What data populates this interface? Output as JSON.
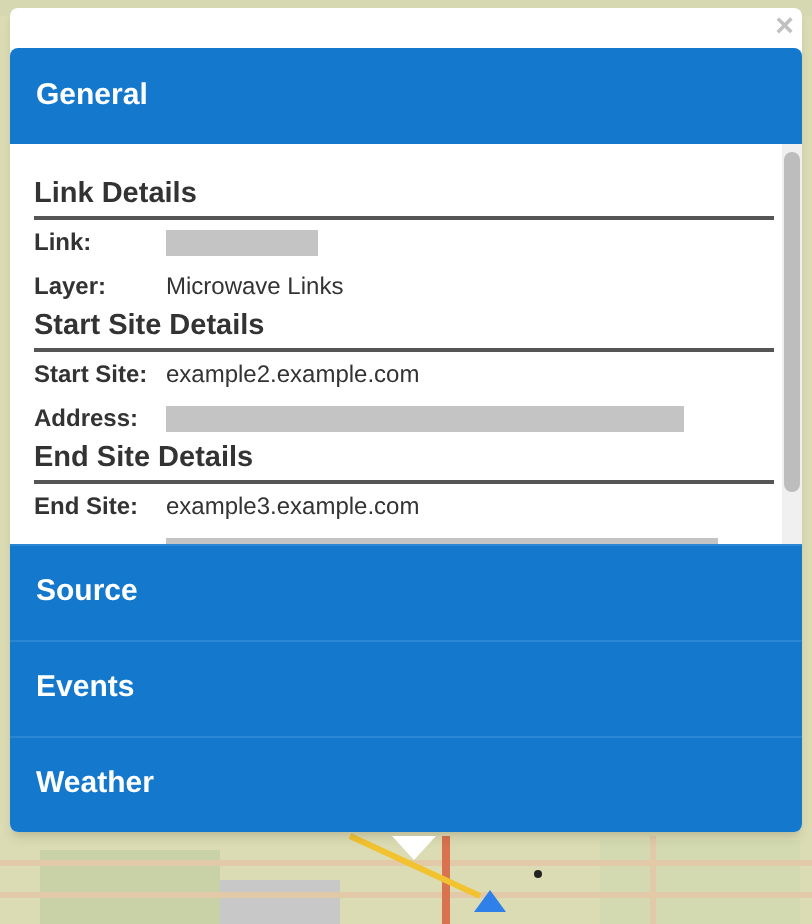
{
  "popup": {
    "close": "×",
    "sections": [
      {
        "title": "General",
        "expanded": true,
        "groups": [
          {
            "heading": "Link Details",
            "rows": [
              {
                "label": "Link:",
                "kind": "redacted"
              },
              {
                "label": "Layer:",
                "kind": "text",
                "value": "Microwave Links"
              }
            ]
          },
          {
            "heading": "Start Site Details",
            "rows": [
              {
                "label": "Start Site:",
                "kind": "text",
                "value": "example2.example.com"
              },
              {
                "label": "Address:",
                "kind": "redacted"
              }
            ]
          },
          {
            "heading": "End Site Details",
            "rows": [
              {
                "label": "End Site:",
                "kind": "text",
                "value": "example3.example.com"
              },
              {
                "kind": "redacted"
              }
            ]
          }
        ]
      },
      {
        "title": "Source",
        "expanded": false
      },
      {
        "title": "Events",
        "expanded": false
      },
      {
        "title": "Weather",
        "expanded": false
      }
    ]
  }
}
